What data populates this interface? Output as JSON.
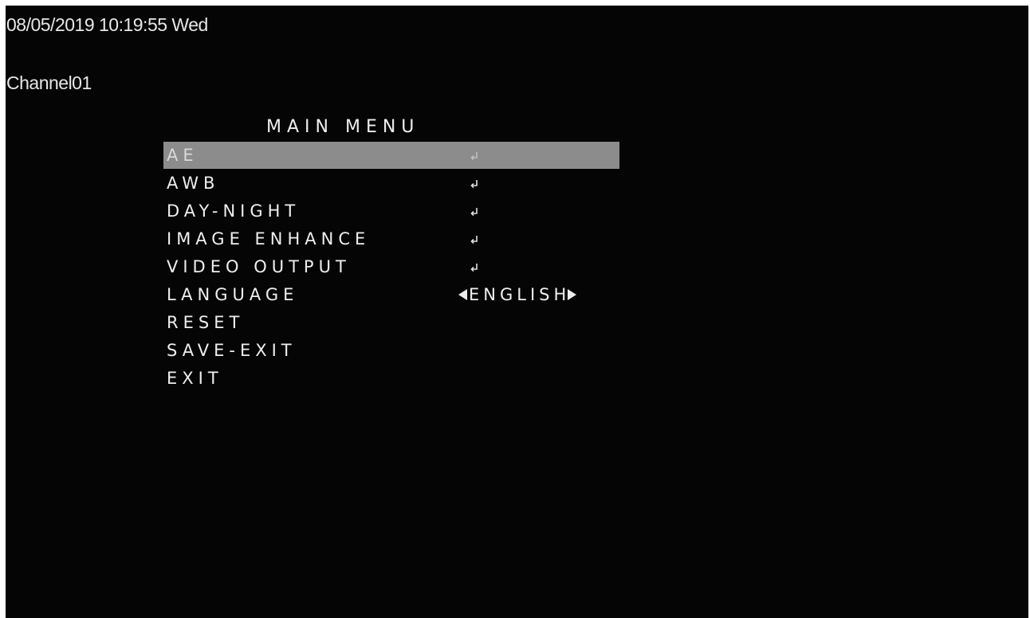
{
  "osd": {
    "timestamp": "08/05/2019 10:19:55 Wed",
    "channel": "Channel01"
  },
  "menu": {
    "title": "MAIN MENU",
    "items": [
      {
        "label": "AE",
        "value": "",
        "submenu": true,
        "selected": true
      },
      {
        "label": "AWB",
        "value": "",
        "submenu": true,
        "selected": false
      },
      {
        "label": "DAY-NIGHT",
        "value": "",
        "submenu": true,
        "selected": false
      },
      {
        "label": "IMAGE ENHANCE",
        "value": "",
        "submenu": true,
        "selected": false
      },
      {
        "label": "VIDEO OUTPUT",
        "value": "",
        "submenu": true,
        "selected": false
      },
      {
        "label": "LANGUAGE",
        "value": "ENGLISH",
        "submenu": false,
        "selected": false
      },
      {
        "label": "RESET",
        "value": "",
        "submenu": false,
        "selected": false
      },
      {
        "label": "SAVE-EXIT",
        "value": "",
        "submenu": false,
        "selected": false
      },
      {
        "label": "EXIT",
        "value": "",
        "submenu": false,
        "selected": false
      }
    ],
    "icons": {
      "submenu": "enter-icon",
      "value_prev": "arrow-left-icon",
      "value_next": "arrow-right-icon"
    }
  },
  "colors": {
    "background": "#050505",
    "text": "#eeeeee",
    "highlight": "#8c8c8c"
  }
}
